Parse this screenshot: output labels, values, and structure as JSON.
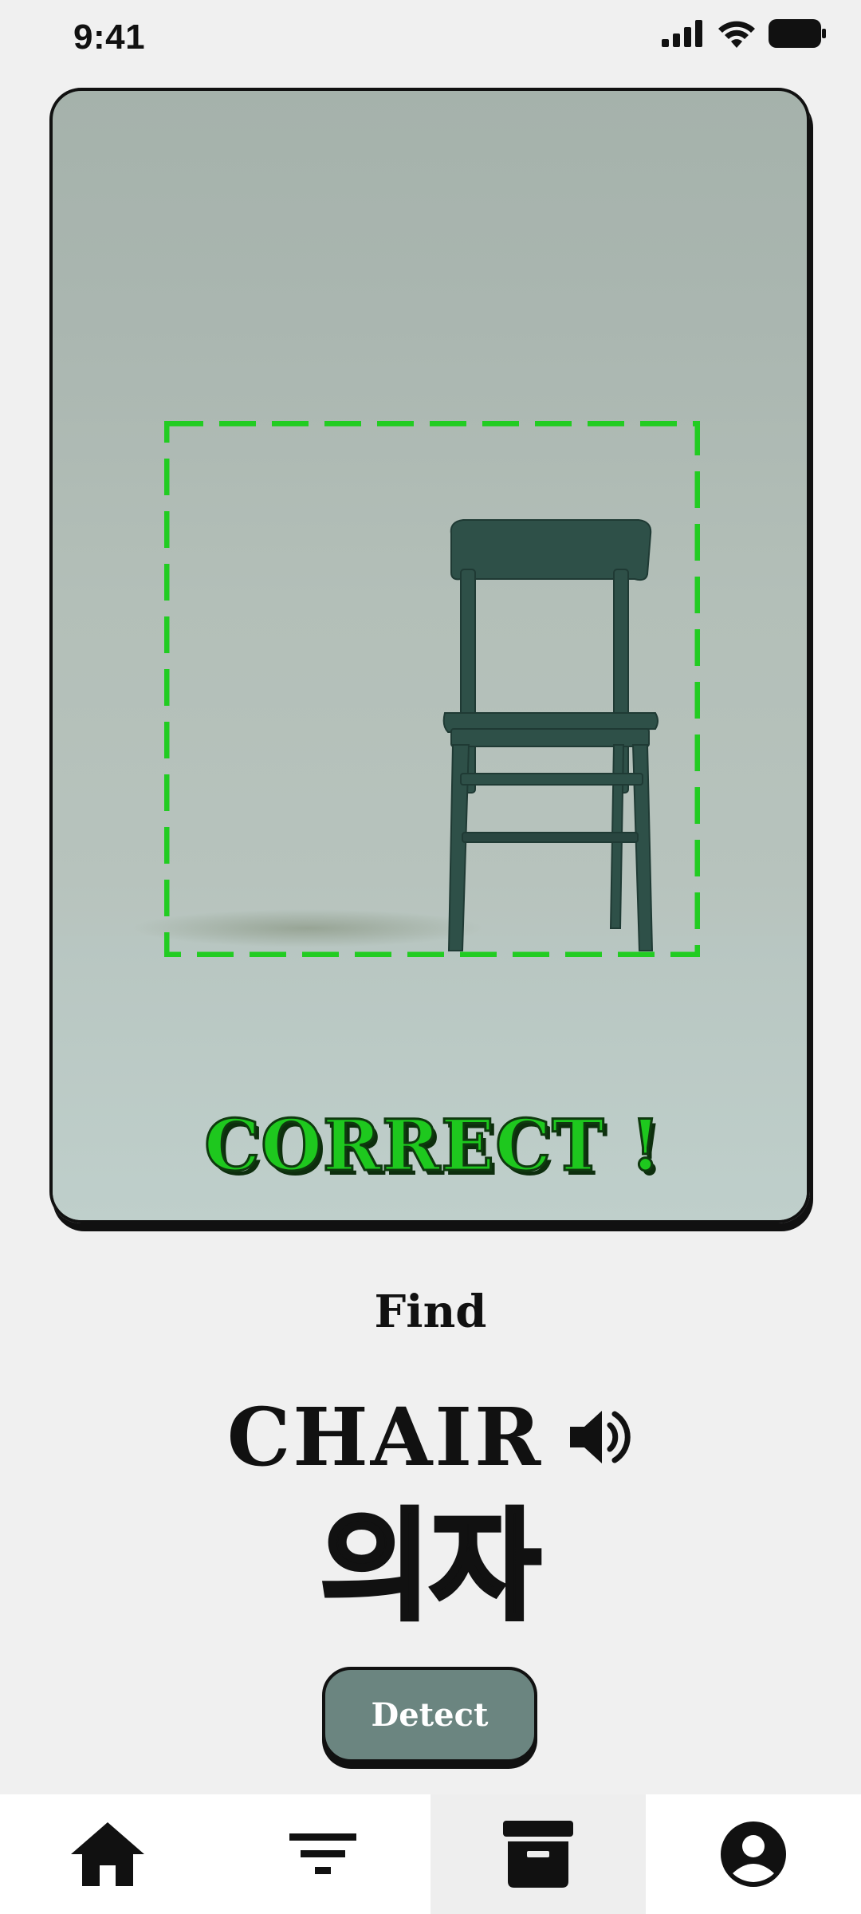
{
  "status_bar": {
    "time": "9:41",
    "icons": [
      "signal-icon",
      "wifi-icon",
      "battery-icon"
    ]
  },
  "camera": {
    "result_text": "CORRECT !",
    "result_color": "#1ec81e",
    "detection_box_color": "#22cc22",
    "scene": "green wooden chair on grey studio backdrop"
  },
  "prompt": {
    "find_label": "Find",
    "target_word": "CHAIR",
    "target_translation": "의자",
    "speaker_icon": "speaker-icon"
  },
  "actions": {
    "detect_label": "Detect",
    "detect_color": "#6b8580"
  },
  "bottom_nav": {
    "items": [
      {
        "icon": "home-icon",
        "active": false
      },
      {
        "icon": "filter-icon",
        "active": false
      },
      {
        "icon": "archive-icon",
        "active": true
      },
      {
        "icon": "account-icon",
        "active": false
      }
    ]
  }
}
